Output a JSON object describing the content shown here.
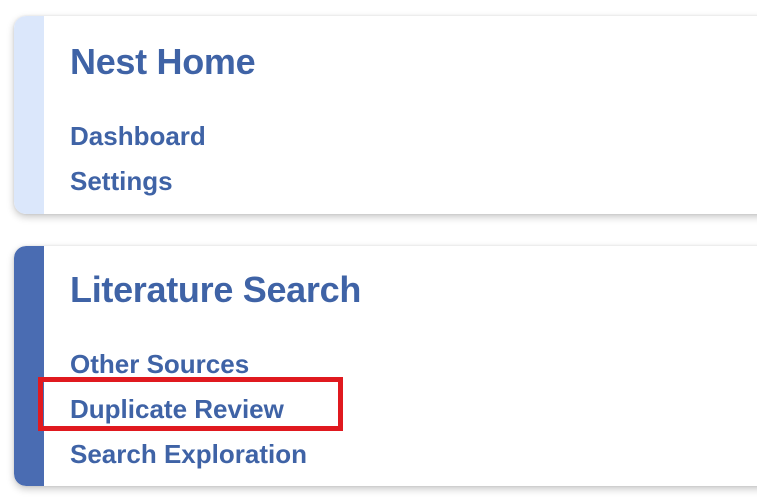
{
  "nest_home": {
    "title": "Nest Home",
    "links": [
      "Dashboard",
      "Settings"
    ]
  },
  "literature_search": {
    "title": "Literature Search",
    "links": [
      "Other Sources",
      "Duplicate Review",
      "Search Exploration"
    ]
  },
  "colors": {
    "link_text": "#3f63a6",
    "home_accent": "#dbe7fb",
    "lit_accent": "#4a6cb2",
    "highlight": "#e0191f"
  }
}
